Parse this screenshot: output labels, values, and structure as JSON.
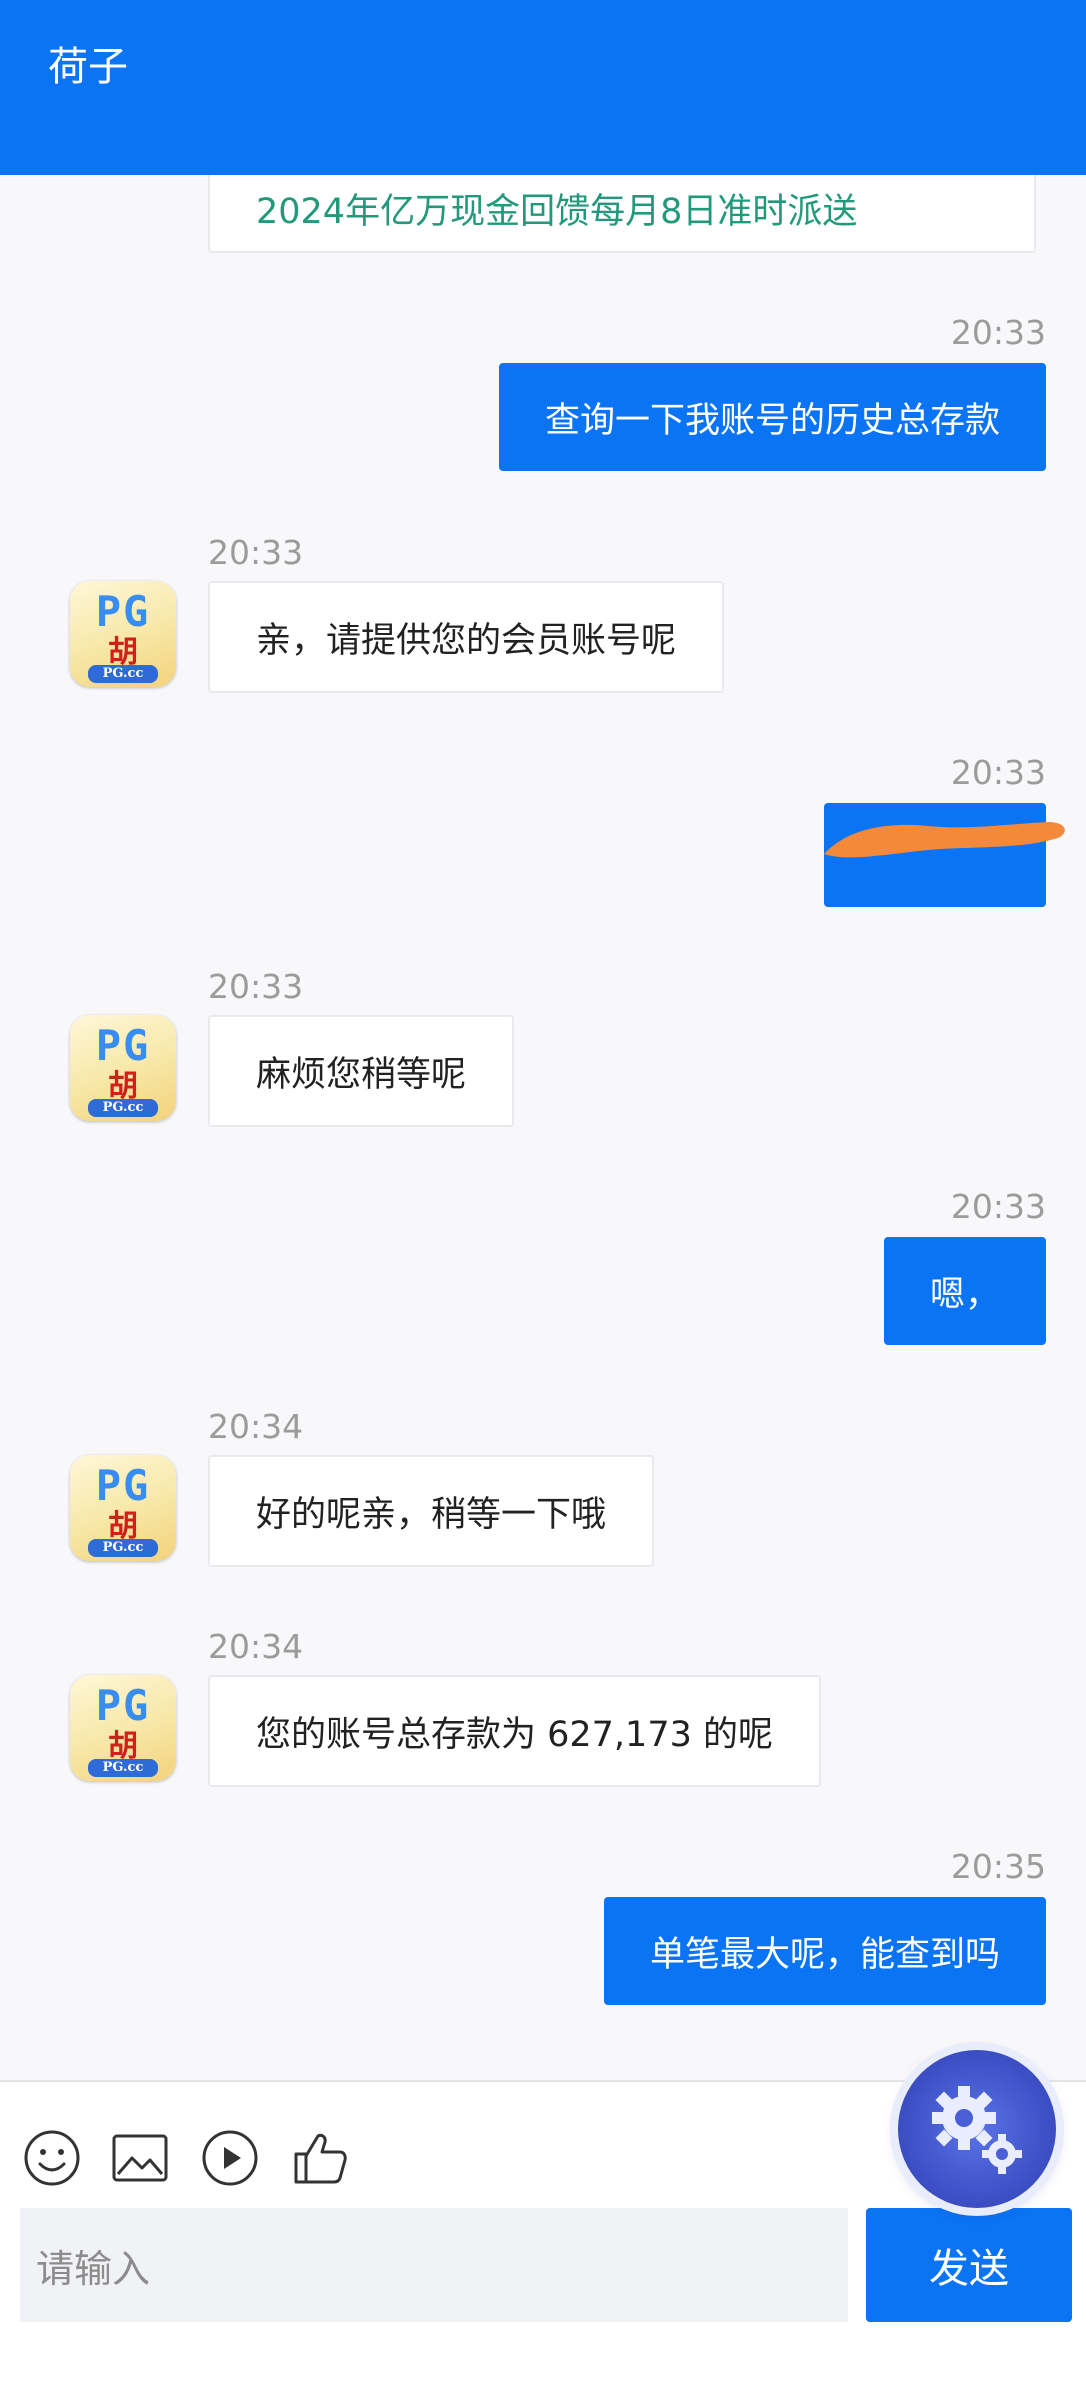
{
  "header": {
    "title": "荷子"
  },
  "avatar": {
    "pg": "PG",
    "hu": "胡",
    "domain": "PG.cc"
  },
  "messages": [
    {
      "side": "in",
      "time": "",
      "text": "2024年亿万现金回馈每月8日准时派送"
    },
    {
      "side": "out",
      "time": "20:33",
      "text": "查询一下我账号的历史总存款"
    },
    {
      "side": "in",
      "time": "20:33",
      "text": "亲，请提供您的会员账号呢"
    },
    {
      "side": "out",
      "time": "20:33",
      "text": ""
    },
    {
      "side": "in",
      "time": "20:33",
      "text": "麻烦您稍等呢"
    },
    {
      "side": "out",
      "time": "20:33",
      "text": "嗯，"
    },
    {
      "side": "in",
      "time": "20:34",
      "text": "好的呢亲，稍等一下哦"
    },
    {
      "side": "in",
      "time": "20:34",
      "text": "您的账号总存款为 627,173 的呢"
    },
    {
      "side": "out",
      "time": "20:35",
      "text": "单笔最大呢，能查到吗"
    }
  ],
  "toolbar": {
    "icons": [
      "emoji-icon",
      "image-icon",
      "video-icon",
      "thumbs-up-icon"
    ],
    "placeholder": "请输入",
    "send_label": "发送"
  },
  "colors": {
    "accent": "#0a74f5",
    "promo_text": "#21997a",
    "redaction": "#f5893a"
  }
}
